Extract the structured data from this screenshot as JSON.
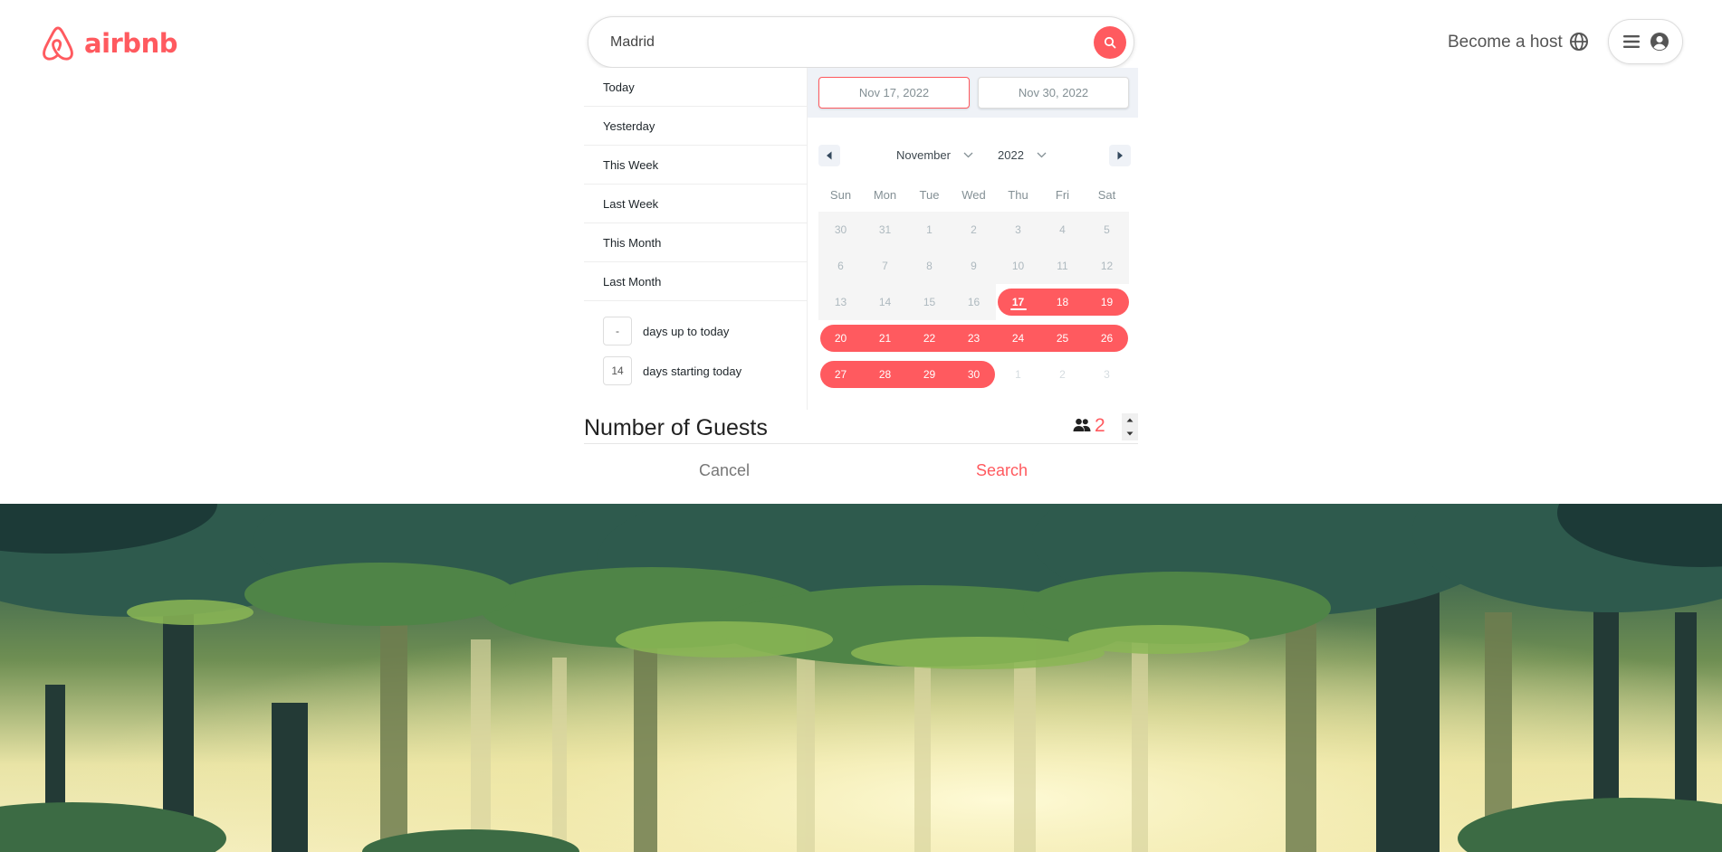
{
  "brand": {
    "name": "airbnb",
    "color": "#ff5a5f"
  },
  "search": {
    "value": "Madrid",
    "button_icon": "search-icon"
  },
  "header": {
    "host_link": "Become a host",
    "globe_icon": "globe-icon",
    "menu_icon": "hamburger-icon",
    "avatar_icon": "user-circle-icon"
  },
  "ranges": {
    "items": [
      "Today",
      "Yesterday",
      "This Week",
      "Last Week",
      "This Month",
      "Last Month"
    ],
    "up_to_today": {
      "value": "-",
      "label": "days up to today"
    },
    "starting_today": {
      "value": "14",
      "label": "days starting today"
    }
  },
  "calendar": {
    "start_date": "Nov 17, 2022",
    "end_date": "Nov 30, 2022",
    "month": "November",
    "year": "2022",
    "weekdays": [
      "Sun",
      "Mon",
      "Tue",
      "Wed",
      "Thu",
      "Fri",
      "Sat"
    ],
    "weeks": [
      [
        "30",
        "31",
        "1",
        "2",
        "3",
        "4",
        "5"
      ],
      [
        "6",
        "7",
        "8",
        "9",
        "10",
        "11",
        "12"
      ],
      [
        "13",
        "14",
        "15",
        "16",
        "17",
        "18",
        "19"
      ],
      [
        "20",
        "21",
        "22",
        "23",
        "24",
        "25",
        "26"
      ],
      [
        "27",
        "28",
        "29",
        "30",
        "1",
        "2",
        "3"
      ]
    ],
    "today": "17",
    "selected_range": [
      "17",
      "30"
    ]
  },
  "guests": {
    "title": "Number of Guests",
    "value": "2",
    "icon": "people-icon"
  },
  "actions": {
    "cancel": "Cancel",
    "search": "Search"
  }
}
